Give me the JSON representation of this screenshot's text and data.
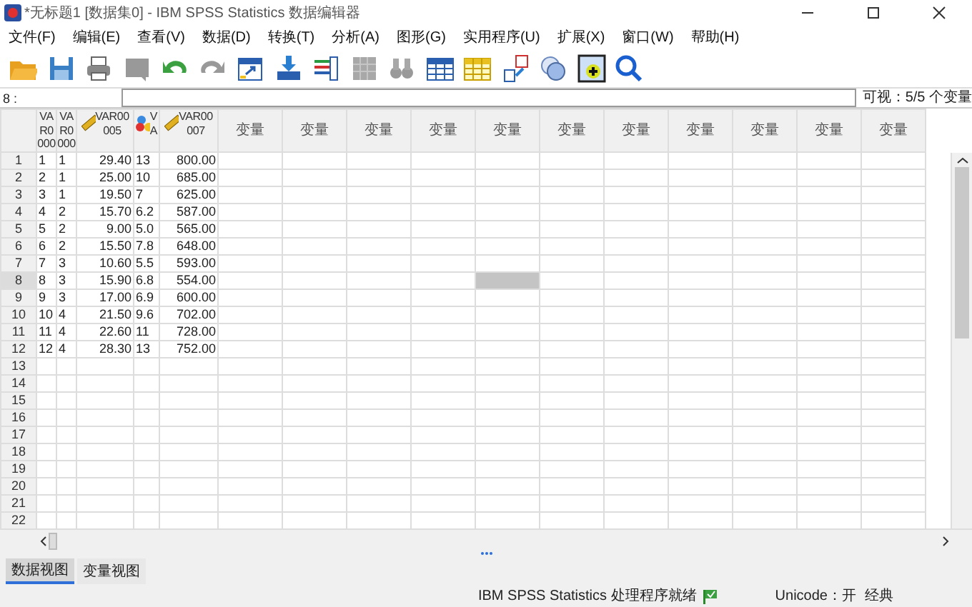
{
  "window": {
    "title": "*无标题1 [数据集0] - IBM SPSS Statistics 数据编辑器"
  },
  "menu": [
    "文件(F)",
    "编辑(E)",
    "查看(V)",
    "数据(D)",
    "转换(T)",
    "分析(A)",
    "图形(G)",
    "实用程序(U)",
    "扩展(X)",
    "窗口(W)",
    "帮助(H)"
  ],
  "toolbar": [
    {
      "kind": "open",
      "disabled": false
    },
    {
      "kind": "save",
      "disabled": false
    },
    {
      "kind": "print",
      "disabled": false
    },
    {
      "kind": "dialog",
      "disabled": true
    },
    {
      "kind": "undo",
      "disabled": false
    },
    {
      "kind": "redo",
      "disabled": true
    },
    {
      "kind": "goto-case",
      "disabled": false
    },
    {
      "kind": "goto-var",
      "disabled": false
    },
    {
      "kind": "variables",
      "disabled": false
    },
    {
      "kind": "descriptives",
      "disabled": true
    },
    {
      "kind": "find",
      "disabled": true
    },
    {
      "kind": "insert-cases",
      "disabled": false
    },
    {
      "kind": "insert-var",
      "disabled": false
    },
    {
      "kind": "value-labels",
      "disabled": false
    },
    {
      "kind": "sets",
      "disabled": false
    },
    {
      "kind": "show-all",
      "disabled": false
    },
    {
      "kind": "search",
      "disabled": false
    }
  ],
  "cell_editor": {
    "label": "8 :",
    "visible": "可视：5/5 个变量"
  },
  "columns": [
    {
      "lines": [
        "VA",
        "R0",
        "000"
      ],
      "kind": "plain",
      "selected": false
    },
    {
      "lines": [
        "VA",
        "R0",
        "000"
      ],
      "kind": "plain",
      "selected": false
    },
    {
      "lines": [
        "VAR00",
        "005"
      ],
      "kind": "scale",
      "selected": false
    },
    {
      "lines": [
        "V",
        "A"
      ],
      "kind": "nominal",
      "selected": false
    },
    {
      "lines": [
        "VAR00",
        "007"
      ],
      "kind": "scale",
      "selected": false
    },
    {
      "lines": [
        "变量"
      ],
      "kind": "empty",
      "selected": false
    },
    {
      "lines": [
        "变量"
      ],
      "kind": "empty",
      "selected": false
    },
    {
      "lines": [
        "变量"
      ],
      "kind": "empty",
      "selected": false
    },
    {
      "lines": [
        "变量"
      ],
      "kind": "empty",
      "selected": false
    },
    {
      "lines": [
        "变量"
      ],
      "kind": "empty",
      "selected": true
    },
    {
      "lines": [
        "变量"
      ],
      "kind": "empty",
      "selected": false
    },
    {
      "lines": [
        "变量"
      ],
      "kind": "empty",
      "selected": false
    },
    {
      "lines": [
        "变量"
      ],
      "kind": "empty",
      "selected": false
    },
    {
      "lines": [
        "变量"
      ],
      "kind": "empty",
      "selected": false
    },
    {
      "lines": [
        "变量"
      ],
      "kind": "empty",
      "selected": false
    },
    {
      "lines": [
        "变量"
      ],
      "kind": "empty",
      "selected": false
    }
  ],
  "rows": [
    {
      "number": "1",
      "selected": false,
      "cells": [
        "1",
        "1",
        "29.40",
        "13",
        "800.00"
      ]
    },
    {
      "number": "2",
      "selected": false,
      "cells": [
        "2",
        "1",
        "25.00",
        "10",
        "685.00"
      ]
    },
    {
      "number": "3",
      "selected": false,
      "cells": [
        "3",
        "1",
        "19.50",
        "7",
        "625.00"
      ]
    },
    {
      "number": "4",
      "selected": false,
      "cells": [
        "4",
        "2",
        "15.70",
        "6.2",
        "587.00"
      ]
    },
    {
      "number": "5",
      "selected": false,
      "cells": [
        "5",
        "2",
        "9.00",
        "5.0",
        "565.00"
      ]
    },
    {
      "number": "6",
      "selected": false,
      "cells": [
        "6",
        "2",
        "15.50",
        "7.8",
        "648.00"
      ]
    },
    {
      "number": "7",
      "selected": false,
      "cells": [
        "7",
        "3",
        "10.60",
        "5.5",
        "593.00"
      ]
    },
    {
      "number": "8",
      "selected": true,
      "cells": [
        "8",
        "3",
        "15.90",
        "6.8",
        "554.00"
      ]
    },
    {
      "number": "9",
      "selected": false,
      "cells": [
        "9",
        "3",
        "17.00",
        "6.9",
        "600.00"
      ]
    },
    {
      "number": "10",
      "selected": false,
      "cells": [
        "10",
        "4",
        "21.50",
        "9.6",
        "702.00"
      ]
    },
    {
      "number": "11",
      "selected": false,
      "cells": [
        "11",
        "4",
        "22.60",
        "11",
        "728.00"
      ]
    },
    {
      "number": "12",
      "selected": false,
      "cells": [
        "12",
        "4",
        "28.30",
        "13",
        "752.00"
      ]
    },
    {
      "number": "13",
      "selected": false,
      "cells": []
    },
    {
      "number": "14",
      "selected": false,
      "cells": []
    },
    {
      "number": "15",
      "selected": false,
      "cells": []
    },
    {
      "number": "16",
      "selected": false,
      "cells": []
    },
    {
      "number": "17",
      "selected": false,
      "cells": []
    },
    {
      "number": "18",
      "selected": false,
      "cells": []
    },
    {
      "number": "19",
      "selected": false,
      "cells": []
    },
    {
      "number": "20",
      "selected": false,
      "cells": []
    },
    {
      "number": "21",
      "selected": false,
      "cells": []
    },
    {
      "number": "22",
      "selected": false,
      "cells": []
    }
  ],
  "tabs": [
    {
      "label": "数据视图",
      "selected": true
    },
    {
      "label": "变量视图",
      "selected": false
    }
  ],
  "status_bar": {
    "message": "IBM SPSS Statistics 处理程序就绪",
    "unicode": "Unicode：开",
    "mode": "经典"
  }
}
